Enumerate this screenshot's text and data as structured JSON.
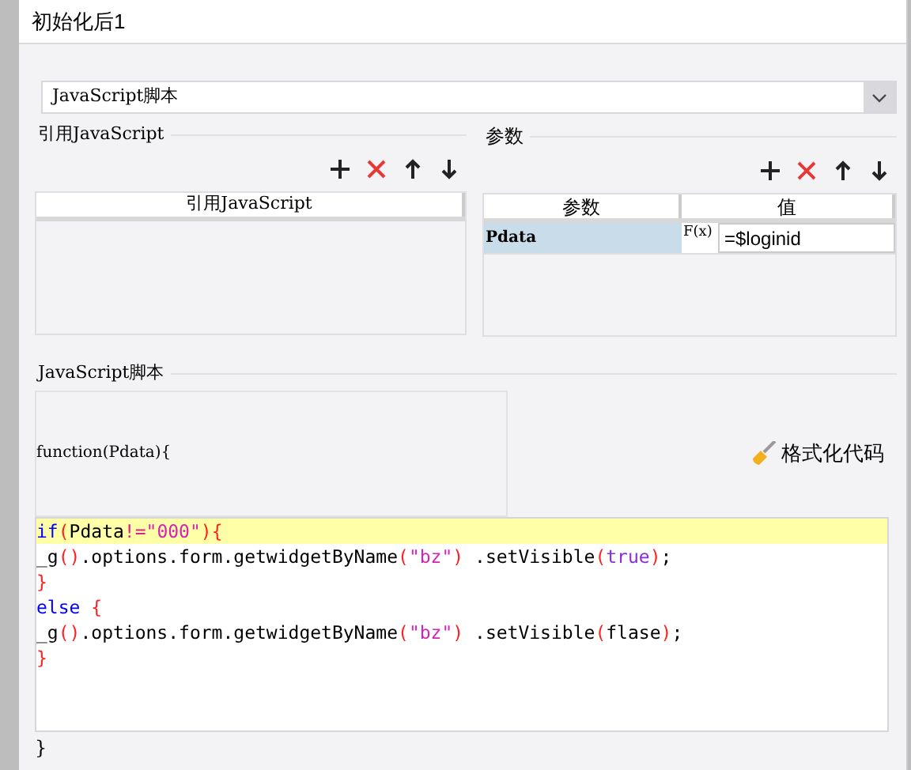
{
  "window": {
    "title": "初始化后1"
  },
  "script_type": {
    "value": "JavaScript脚本"
  },
  "ref_js": {
    "label": "引用JavaScript",
    "columns": [
      "引用JavaScript"
    ]
  },
  "params": {
    "label": "参数",
    "columns": [
      "参数",
      "值"
    ],
    "rows": [
      {
        "name": "Pdata",
        "formula_button": "F(x)",
        "value": "=$loginid",
        "selected": true
      }
    ]
  },
  "script_section": {
    "label": "JavaScript脚本",
    "header": "function(Pdata){",
    "format_button": "格式化代码",
    "footer": "}",
    "lines": [
      {
        "highlighted": true,
        "tokens": [
          {
            "kind": "keyword",
            "text": "if"
          },
          {
            "kind": "paren",
            "text": "("
          },
          {
            "kind": "plain",
            "text": "Pdata"
          },
          {
            "kind": "operator",
            "text": "!="
          },
          {
            "kind": "string",
            "text": "\"000\""
          },
          {
            "kind": "paren",
            "text": "){"
          }
        ]
      },
      {
        "highlighted": false,
        "tokens": [
          {
            "kind": "plain",
            "text": "_g"
          },
          {
            "kind": "paren",
            "text": "()"
          },
          {
            "kind": "plain",
            "text": ".options.form.getwidgetByName"
          },
          {
            "kind": "paren",
            "text": "("
          },
          {
            "kind": "string",
            "text": "\"bz\""
          },
          {
            "kind": "paren",
            "text": ")"
          },
          {
            "kind": "plain",
            "text": " .setVisible"
          },
          {
            "kind": "paren",
            "text": "("
          },
          {
            "kind": "literal",
            "text": "true"
          },
          {
            "kind": "paren",
            "text": ")"
          },
          {
            "kind": "plain",
            "text": ";"
          }
        ]
      },
      {
        "highlighted": false,
        "tokens": [
          {
            "kind": "paren",
            "text": "}"
          }
        ]
      },
      {
        "highlighted": false,
        "tokens": [
          {
            "kind": "keyword",
            "text": "else"
          },
          {
            "kind": "paren",
            "text": " {"
          }
        ]
      },
      {
        "highlighted": false,
        "tokens": [
          {
            "kind": "plain",
            "text": "_g"
          },
          {
            "kind": "paren",
            "text": "()"
          },
          {
            "kind": "plain",
            "text": ".options.form.getwidgetByName"
          },
          {
            "kind": "paren",
            "text": "("
          },
          {
            "kind": "string",
            "text": "\"bz\""
          },
          {
            "kind": "paren",
            "text": ")"
          },
          {
            "kind": "plain",
            "text": " .setVisible"
          },
          {
            "kind": "paren",
            "text": "("
          },
          {
            "kind": "plain",
            "text": "flase"
          },
          {
            "kind": "paren",
            "text": ")"
          },
          {
            "kind": "plain",
            "text": ";"
          }
        ]
      },
      {
        "highlighted": false,
        "tokens": [
          {
            "kind": "paren",
            "text": "}"
          }
        ]
      }
    ]
  }
}
